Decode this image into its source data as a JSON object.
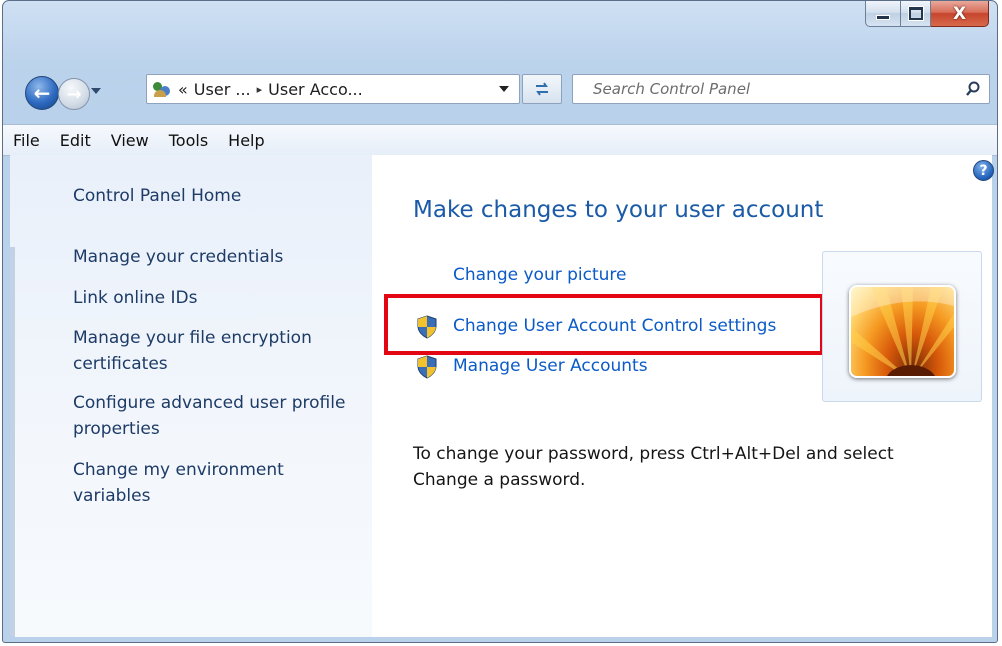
{
  "window": {
    "caption": {
      "minimize_icon": "minimize-icon",
      "maximize_icon": "maximize-icon",
      "close_glyph": "X"
    }
  },
  "navbar": {
    "back_icon": "back-arrow-icon",
    "forward_icon": "forward-arrow-icon",
    "address": {
      "prefix": "«",
      "crumb1": "User ...",
      "separator": "▸",
      "crumb2": "User Acco..."
    },
    "refresh_icon": "refresh-icon",
    "search": {
      "placeholder": "Search Control Panel"
    }
  },
  "menubar": {
    "items": [
      "File",
      "Edit",
      "View",
      "Tools",
      "Help"
    ]
  },
  "sidebar": {
    "items": [
      {
        "label": "Control Panel Home"
      },
      {
        "label": "Manage your credentials"
      },
      {
        "label": "Link online IDs"
      },
      {
        "label": "Manage your file encryption certificates"
      },
      {
        "label": "Configure advanced user profile properties"
      },
      {
        "label": "Change my environment variables"
      }
    ]
  },
  "main": {
    "help_glyph": "?",
    "title": "Make changes to your user account",
    "tasks": [
      {
        "label": "Change your picture",
        "icon": ""
      },
      {
        "label": "Change User Account Control settings",
        "icon": "uac-shield-icon"
      },
      {
        "label": "Manage User Accounts",
        "icon": "uac-shield-icon"
      }
    ],
    "password_note": "To change your password, press Ctrl+Alt+Del and select Change a password."
  },
  "colors": {
    "link": "#0a5ac8",
    "title": "#1a5aa6",
    "highlight": "#e30613"
  }
}
